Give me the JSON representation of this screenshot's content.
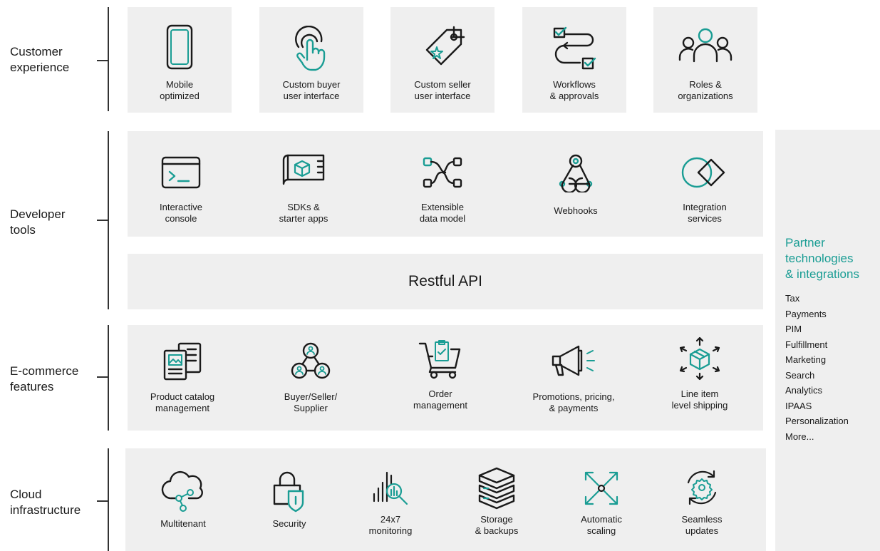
{
  "layers": {
    "customer": {
      "label": "Customer\nexperience",
      "items": [
        {
          "icon": "mobile-icon",
          "caption": "Mobile\noptimized"
        },
        {
          "icon": "touch-hand-icon",
          "caption": "Custom buyer\nuser interface"
        },
        {
          "icon": "price-tag-icon",
          "caption": "Custom seller\nuser interface"
        },
        {
          "icon": "workflow-checkbox-icon",
          "caption": "Workflows\n& approvals"
        },
        {
          "icon": "people-group-icon",
          "caption": "Roles &\norganizations"
        }
      ]
    },
    "developer": {
      "label": "Developer\ntools",
      "items": [
        {
          "icon": "console-icon",
          "caption": "Interactive\nconsole"
        },
        {
          "icon": "blueprint-icon",
          "caption": "SDKs &\nstarter apps"
        },
        {
          "icon": "data-model-icon",
          "caption": "Extensible\ndata model"
        },
        {
          "icon": "webhooks-icon",
          "caption": "Webhooks"
        },
        {
          "icon": "integration-icon",
          "caption": "Integration\nservices"
        }
      ],
      "api_label": "Restful API"
    },
    "ecommerce": {
      "label": "E-commerce\nfeatures",
      "items": [
        {
          "icon": "catalog-icon",
          "caption": "Product catalog\nmanagement"
        },
        {
          "icon": "buyer-seller-icon",
          "caption": "Buyer/Seller/\nSupplier"
        },
        {
          "icon": "shopping-cart-icon",
          "caption": "Order\nmanagement"
        },
        {
          "icon": "megaphone-icon",
          "caption": "Promotions, pricing,\n& payments"
        },
        {
          "icon": "shipping-box-icon",
          "caption": "Line item\nlevel shipping"
        }
      ]
    },
    "cloud": {
      "label": "Cloud\ninfrastructure",
      "items": [
        {
          "icon": "cloud-network-icon",
          "caption": "Multitenant"
        },
        {
          "icon": "lock-shield-icon",
          "caption": "Security"
        },
        {
          "icon": "monitoring-icon",
          "caption": "24x7\nmonitoring"
        },
        {
          "icon": "storage-stack-icon",
          "caption": "Storage\n& backups"
        },
        {
          "icon": "scaling-arrows-icon",
          "caption": "Automatic\nscaling"
        },
        {
          "icon": "update-gear-icon",
          "caption": "Seamless\nupdates"
        }
      ]
    }
  },
  "partner": {
    "title": "Partner\ntechnologies\n& integrations",
    "items": [
      "Tax",
      "Payments",
      "PIM",
      "Fulfillment",
      "Marketing",
      "Search",
      "Analytics",
      "IPAAS",
      "Personalization",
      "More..."
    ]
  },
  "colors": {
    "accent": "#1a9d94",
    "tile": "#efefef",
    "line": "#333333",
    "icon_stroke": "#1a1a1a"
  }
}
